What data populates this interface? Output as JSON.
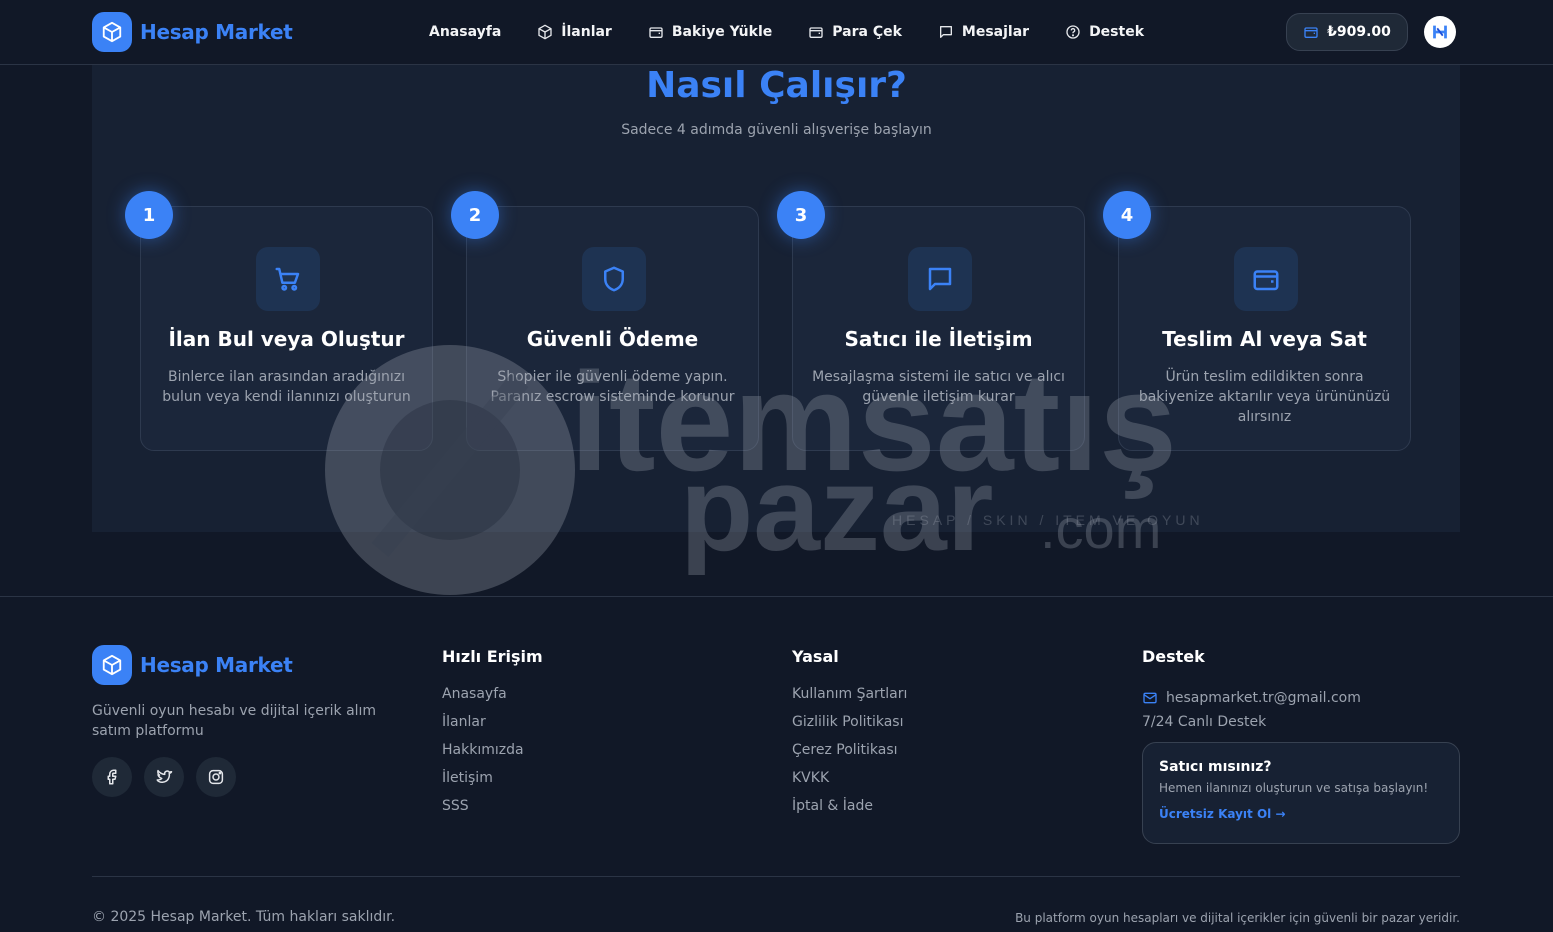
{
  "header": {
    "brand": "Hesap Market",
    "nav": [
      {
        "label": "Anasayfa",
        "icon": "home"
      },
      {
        "label": "İlanlar",
        "icon": "cube-icon"
      },
      {
        "label": "Bakiye Yükle",
        "icon": "wallet-icon"
      },
      {
        "label": "Para Çek",
        "icon": "wallet-icon"
      },
      {
        "label": "Mesajlar",
        "icon": "message-icon"
      },
      {
        "label": "Destek",
        "icon": "help-circle-icon"
      }
    ],
    "balance": "₺909.00"
  },
  "how": {
    "title": "Nasıl Çalışır?",
    "subtitle": "Sadece 4 adımda güvenli alışverişe başlayın",
    "steps": [
      {
        "num": "1",
        "title": "İlan Bul veya Oluştur",
        "desc": "Binlerce ilan arasından aradığınızı bulun veya kendi ilanınızı oluşturun",
        "icon": "cart-icon"
      },
      {
        "num": "2",
        "title": "Güvenli Ödeme",
        "desc": "Shopier ile güvenli ödeme yapın. Paranız escrow sisteminde korunur",
        "icon": "shield-icon"
      },
      {
        "num": "3",
        "title": "Satıcı ile İletişim",
        "desc": "Mesajlaşma sistemi ile satıcı ve alıcı güvenle iletişim kurar",
        "icon": "message-icon"
      },
      {
        "num": "4",
        "title": "Teslim Al veya Sat",
        "desc": "Ürün teslim edildikten sonra bakiyenize aktarılır veya ürününüzü alırsınız",
        "icon": "wallet-icon"
      }
    ]
  },
  "watermark": {
    "line1": "itemsatış",
    "line2": "pazar",
    "suffix": ".com",
    "tagline": "HESAP / SKIN / ITEM VE OYUN"
  },
  "footer": {
    "brand": "Hesap Market",
    "description": "Güvenli oyun hesabı ve dijital içerik alım satım platformu",
    "quick": {
      "title": "Hızlı Erişim",
      "links": [
        "Anasayfa",
        "İlanlar",
        "Hakkımızda",
        "İletişim",
        "SSS"
      ]
    },
    "legal": {
      "title": "Yasal",
      "links": [
        "Kullanım Şartları",
        "Gizlilik Politikası",
        "Çerez Politikası",
        "KVKK",
        "İptal & İade"
      ]
    },
    "support": {
      "title": "Destek",
      "email": "hesapmarket.tr@gmail.com",
      "live": "7/24 Canlı Destek",
      "seller_title": "Satıcı mısınız?",
      "seller_text": "Hemen ilanınızı oluşturun ve satışa başlayın!",
      "seller_link": "Ücretsiz Kayıt Ol →"
    },
    "copyright": "© 2025 Hesap Market. Tüm hakları saklıdır.",
    "note": "Bu platform oyun hesapları ve dijital içerikler için güvenli bir pazar yeridir."
  },
  "colors": {
    "accent": "#3b82f6",
    "background": "#111827",
    "card": "#1b263a"
  }
}
